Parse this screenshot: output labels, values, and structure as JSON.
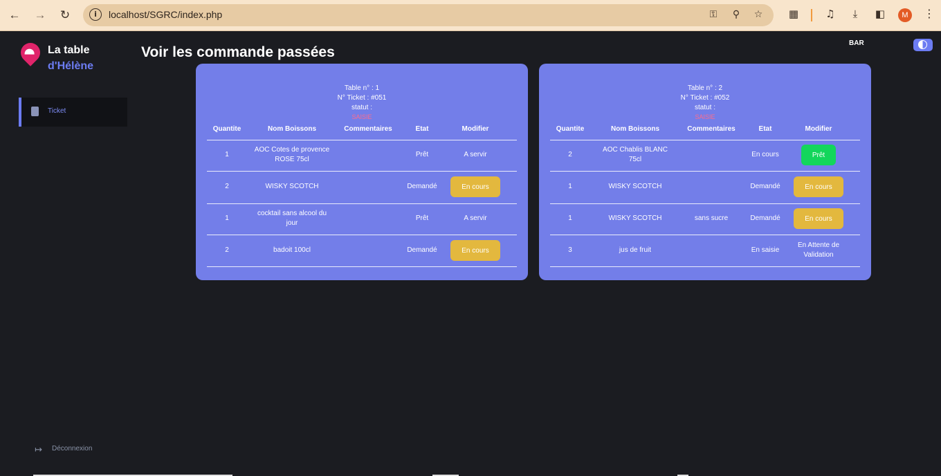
{
  "browser": {
    "url": "localhost/SGRC/index.php",
    "avatar_letter": "M",
    "icons": [
      "back-icon",
      "forward-icon",
      "reload-icon",
      "info-icon",
      "key-icon",
      "zoom-icon",
      "star-icon",
      "extensions-icon",
      "media-icon",
      "download-icon",
      "sidepanel-icon",
      "menu-icon"
    ]
  },
  "sidebar": {
    "brand_line1": "La table",
    "brand_line2": "d'Hélène",
    "items": [
      {
        "label": "Ticket",
        "icon": "clipboard-icon"
      }
    ],
    "logout_label": "Déconnexion"
  },
  "header": {
    "title": "Voir les commande passées",
    "role": "BAR"
  },
  "colors": {
    "accent": "#6c7cf2",
    "card": "#737ee9",
    "button_pending": "#e3b83e",
    "button_ready": "#13d65b",
    "statut": "#ff6b8b"
  },
  "columns": [
    "Quantite",
    "Nom Boissons",
    "Commentaires",
    "Etat",
    "Modifier"
  ],
  "tickets": [
    {
      "table": "Table n° : 1",
      "ticket": "N° Ticket : #051",
      "statut_label": "statut :",
      "statut": "SAISIE",
      "rows": [
        {
          "qty": "1",
          "name": "AOC Cotes de provence ROSE 75cl",
          "comment": "",
          "etat": "Prêt",
          "modifier": "A servir",
          "modifier_type": "text"
        },
        {
          "qty": "2",
          "name": "WISKY SCOTCH",
          "comment": "",
          "etat": "Demandé",
          "modifier": "En cours",
          "modifier_type": "yellow"
        },
        {
          "qty": "1",
          "name": "cocktail sans alcool du jour",
          "comment": "",
          "etat": "Prêt",
          "modifier": "A servir",
          "modifier_type": "text"
        },
        {
          "qty": "2",
          "name": "badoit 100cl",
          "comment": "",
          "etat": "Demandé",
          "modifier": "En cours",
          "modifier_type": "yellow"
        }
      ]
    },
    {
      "table": "Table n° : 2",
      "ticket": "N° Ticket : #052",
      "statut_label": "statut :",
      "statut": "SAISIE",
      "rows": [
        {
          "qty": "2",
          "name": "AOC Chablis BLANC 75cl",
          "comment": "",
          "etat": "En cours",
          "modifier": "Prêt",
          "modifier_type": "green"
        },
        {
          "qty": "1",
          "name": "WISKY SCOTCH",
          "comment": "",
          "etat": "Demandé",
          "modifier": "En cours",
          "modifier_type": "yellow"
        },
        {
          "qty": "1",
          "name": "WISKY SCOTCH",
          "comment": "sans sucre",
          "etat": "Demandé",
          "modifier": "En cours",
          "modifier_type": "yellow"
        },
        {
          "qty": "3",
          "name": "jus de fruit",
          "comment": "",
          "etat": "En saisie",
          "modifier": "En Attente de Validation",
          "modifier_type": "text"
        }
      ]
    }
  ]
}
